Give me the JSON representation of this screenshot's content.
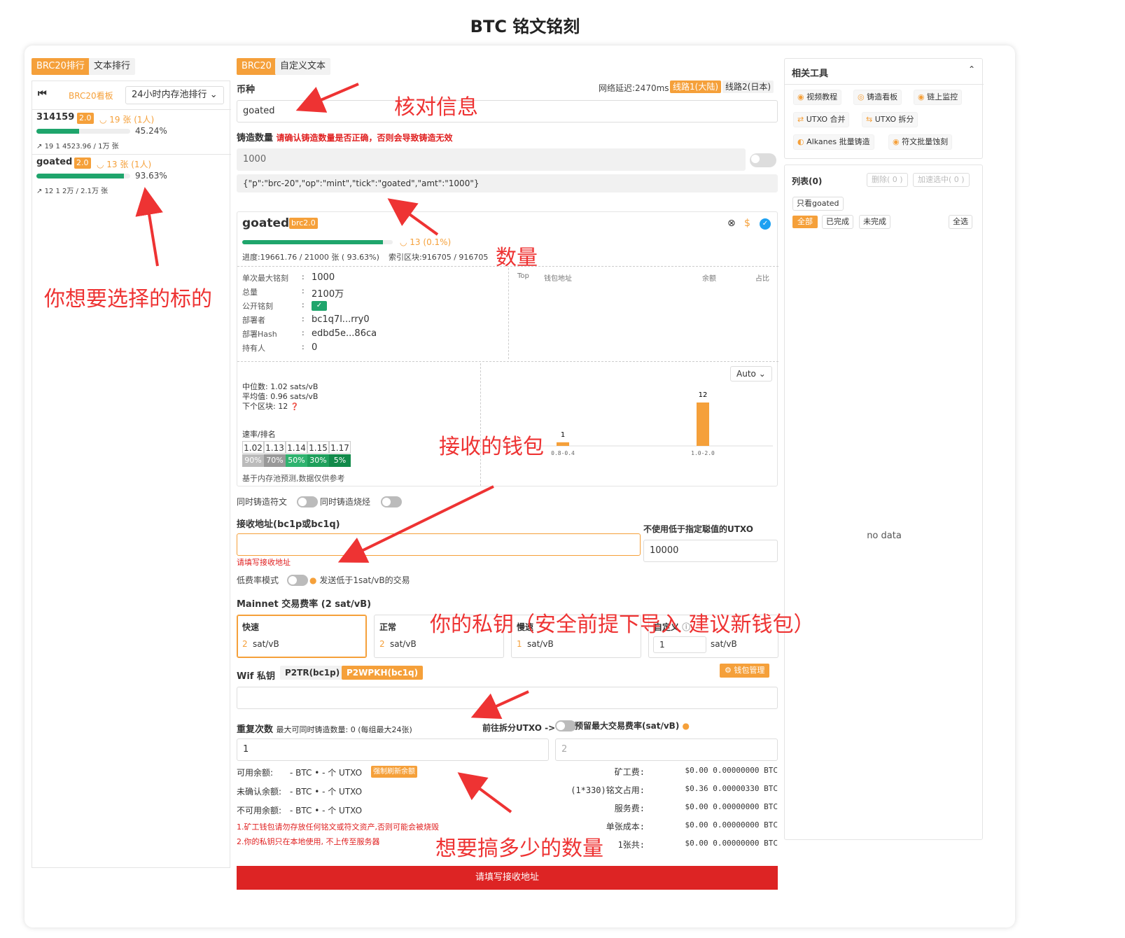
{
  "page_title": "BTC 铭文铭刻",
  "left": {
    "tabs": [
      "BRC20排行",
      "文本排行"
    ],
    "board_label": "BRC20看板",
    "sort_select": "24小时内存池排行",
    "items": [
      {
        "ticker": "314159",
        "version": "2.0",
        "count": "19 张 (1人)",
        "pct": "45.24%",
        "progress": 0.4524,
        "meta": "19  1  4523.96 / 1万 张"
      },
      {
        "ticker": "goated",
        "version": "2.0",
        "count": "13 张 (1人)",
        "pct": "93.63%",
        "progress": 0.9363,
        "meta": "12  1  2万 / 2.1万 张"
      }
    ]
  },
  "center": {
    "tabs": [
      "BRC20",
      "自定义文本"
    ],
    "coin_label": "币种",
    "latency": "网络延迟:2470ms",
    "route1": "线路1(大陆)",
    "route2": "线路2(日本)",
    "coin_value": "goated",
    "mint_amount_label": "铸造数量",
    "mint_amount_warning": "请确认铸造数量是否正确，否则会导致铸造无效",
    "mint_amount_value": "1000",
    "json_text": "{\"p\":\"brc-20\",\"op\":\"mint\",\"tick\":\"goated\",\"amt\":\"1000\"}",
    "token": {
      "name": "goated",
      "badge": "brc2.0",
      "pending": "13 (0.1%)",
      "progress": 0.9363,
      "progress_text": "进度:19661.76 / 21000 张 ( 93.63%)",
      "index_text": "索引区块:916705 / 916705",
      "fields": [
        {
          "k": "单次最大铭刻",
          "v": "1000"
        },
        {
          "k": "总量",
          "v": "2100万"
        },
        {
          "k": "公开铭刻",
          "v": ""
        },
        {
          "k": "部署者",
          "v": "bc1q7l...rry0"
        },
        {
          "k": "部署Hash",
          "v": "edbd5e...86ca"
        },
        {
          "k": "持有人",
          "v": "0"
        }
      ],
      "holders_headers": [
        "Top",
        "钱包地址",
        "余额",
        "占比"
      ],
      "auto_select": "Auto",
      "median": "中位数: 1.02 sats/vB",
      "average": "平均值: 0.96 sats/vB",
      "next_block": "下个区块: 12",
      "rate_label": "速率/排名",
      "rates": [
        "1.02",
        "1.13",
        "1.14",
        "1.15",
        "1.17"
      ],
      "ranks": [
        "90%",
        "70%",
        "50%",
        "30%",
        "5%"
      ],
      "footnote": "基于内存池预测,数据仅供参考",
      "chart_data": {
        "type": "bar",
        "categories": [
          "0.8-0.4",
          "1.0-2.0"
        ],
        "values": [
          1,
          12
        ]
      }
    },
    "toggle1": "同时铸造符文",
    "toggle2": "同时铸造烧烃",
    "recv_label": "接收地址(bc1p或bc1q)",
    "recv_error": "请填写接收地址",
    "utxo_label": "不使用低于指定聪值的UTXO",
    "utxo_value": "10000",
    "lowfee_label": "低费率模式",
    "lowfee_desc": "发送低于1sat/vB的交易",
    "fee_label": "Mainnet 交易费率 (2 sat/vB)",
    "fees": [
      {
        "name": "快速",
        "num": "2",
        "unit": "sat/vB"
      },
      {
        "name": "正常",
        "num": "2",
        "unit": "sat/vB"
      },
      {
        "name": "慢速",
        "num": "1",
        "unit": "sat/vB"
      }
    ],
    "custom_fee_label": "自定义",
    "custom_fee_value": "1",
    "custom_fee_unit": "sat/vB",
    "wif_label": "Wif 私钥",
    "wif_p2tr": "P2TR(bc1p)",
    "wif_p2wpkh": "P2WPKH(bc1q)",
    "wallet_btn": "钱包管理",
    "repeat_label": "重复次数",
    "repeat_desc": "最大可同时铸造数量: 0 (每组最大24张)",
    "split_label": "前往拆分UTXO ->",
    "reserve_label": "预留最大交易费率(sat/vB)",
    "repeat_value": "1",
    "reserve_placeholder": "2",
    "balances": [
      {
        "k": "可用余额:",
        "v": "- BTC • - 个 UTXO",
        "tag": "强制刷新余额"
      },
      {
        "k": "未确认余额:",
        "v": "- BTC • - 个 UTXO",
        "tag": ""
      },
      {
        "k": "不可用余额:",
        "v": "- BTC • - 个 UTXO",
        "tag": ""
      }
    ],
    "notes": [
      "1.矿工钱包请勿存放任何铭文或符文资产,否则可能会被烧毁",
      "2.你的私钥只在本地使用, 不上传至服务器"
    ],
    "costs": [
      {
        "k": "矿工费:",
        "v": "$0.00 0.00000000 BTC"
      },
      {
        "k": "(1*330)铭文占用:",
        "v": "$0.36 0.00000330 BTC"
      },
      {
        "k": "服务费:",
        "v": "$0.00 0.00000000 BTC"
      },
      {
        "k": "单张成本:",
        "v": "$0.00 0.00000000 BTC"
      },
      {
        "k": "1张共:",
        "v": "$0.00 0.00000000 BTC"
      }
    ],
    "submit": "请填写接收地址"
  },
  "right": {
    "tools_title": "相关工具",
    "tools": [
      "视频教程",
      "铸造看板",
      "链上监控",
      "UTXO 合并",
      "UTXO 拆分",
      "Alkanes 批量铸造",
      "符文批量蚀刻"
    ],
    "list_title": "列表(0)",
    "delete_btn": "删除( 0 )",
    "speed_btn": "加速选中( 0 )",
    "only_goated": "只看goated",
    "filters": [
      "全部",
      "已完成",
      "未完成"
    ],
    "select_all": "全选",
    "no_data": "no data"
  },
  "annotations": {
    "verify": "核对信息",
    "target": "你想要选择的标的",
    "qty": "数量",
    "wallet": "接收的钱包",
    "privkey": "你的私钥（安全前提下导入 建议新钱包）",
    "howmany": "想要搞多少的数量"
  }
}
